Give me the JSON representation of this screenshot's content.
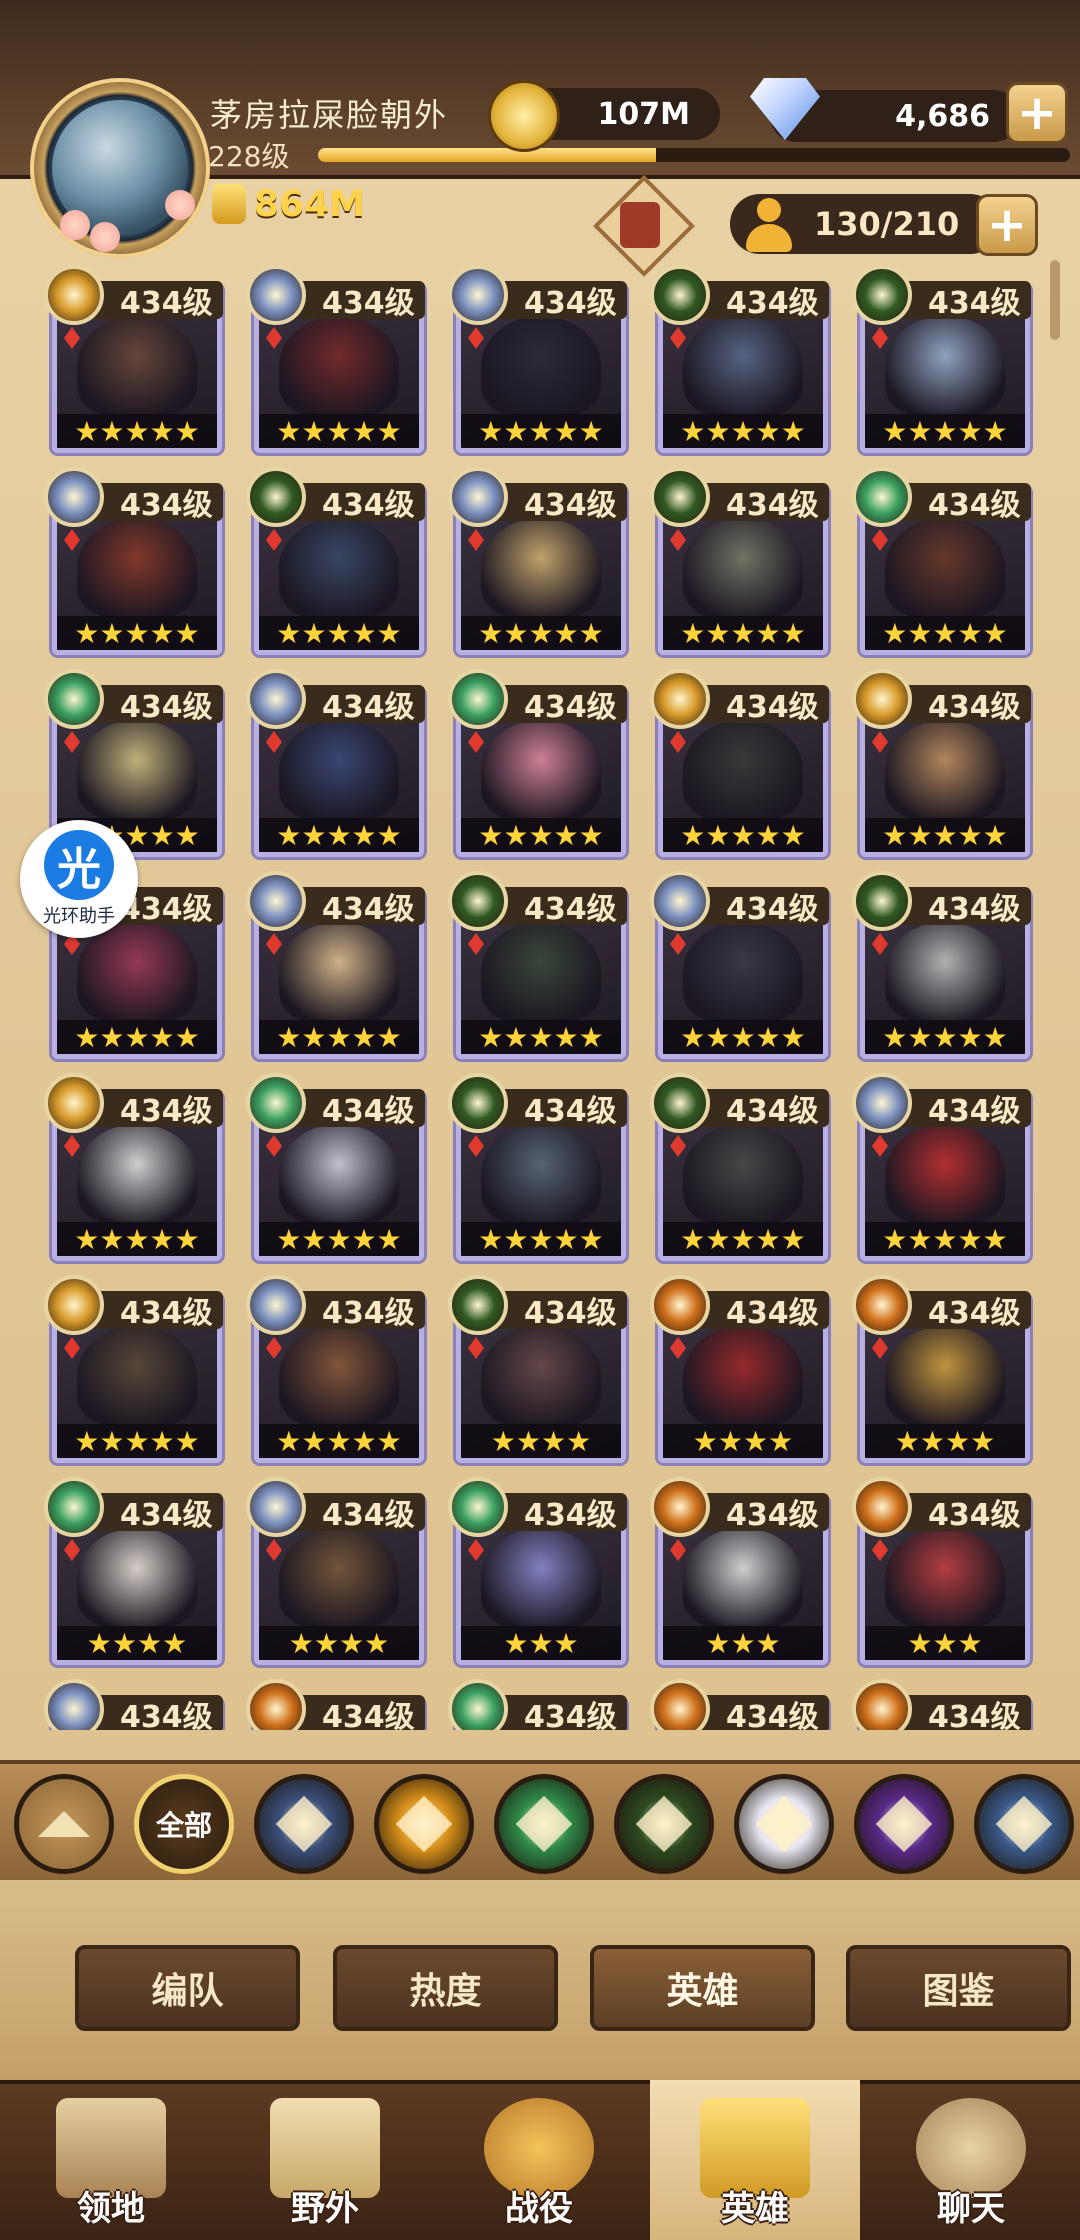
{
  "player": {
    "name": "茅房拉屎脸朝外",
    "level": "228级",
    "power": "864M",
    "xp_fraction": 0.45
  },
  "resources": {
    "gold": "107M",
    "gems": "4,686",
    "hero_count": "130/210"
  },
  "helper": {
    "logo_char": "光",
    "label": "光环助手"
  },
  "heroes": {
    "rows": [
      [
        {
          "level": "434级",
          "stars": "★★★★★",
          "faction": "lightbearer",
          "hue": "#6b4a3a"
        },
        {
          "level": "434级",
          "stars": "★★★★★",
          "faction": "celestial",
          "hue": "#7a2a2a"
        },
        {
          "level": "434级",
          "stars": "★★★★★",
          "faction": "celestial",
          "hue": "#2a2a3a"
        },
        {
          "level": "434级",
          "stars": "★★★★★",
          "faction": "graveborn",
          "hue": "#5a6a8a"
        },
        {
          "level": "434级",
          "stars": "★★★★★",
          "faction": "graveborn",
          "hue": "#9ab0d0"
        }
      ],
      [
        {
          "level": "434级",
          "stars": "★★★★★",
          "faction": "celestial",
          "hue": "#8a3a2a"
        },
        {
          "level": "434级",
          "stars": "★★★★★",
          "faction": "graveborn",
          "hue": "#3a4a6a"
        },
        {
          "level": "434级",
          "stars": "★★★★★",
          "faction": "celestial",
          "hue": "#d0b070"
        },
        {
          "level": "434级",
          "stars": "★★★★★",
          "faction": "graveborn",
          "hue": "#7a7a6a"
        },
        {
          "level": "434级",
          "stars": "★★★★★",
          "faction": "wilder",
          "hue": "#6a3a2a"
        }
      ],
      [
        {
          "level": "434级",
          "stars": "★★★★★",
          "faction": "wilder",
          "hue": "#d0c080"
        },
        {
          "level": "434级",
          "stars": "★★★★★",
          "faction": "celestial",
          "hue": "#3a4a7a"
        },
        {
          "level": "434级",
          "stars": "★★★★★",
          "faction": "wilder",
          "hue": "#e08aa0"
        },
        {
          "level": "434级",
          "stars": "★★★★★",
          "faction": "lightbearer",
          "hue": "#3a3a3a"
        },
        {
          "level": "434级",
          "stars": "★★★★★",
          "faction": "lightbearer",
          "hue": "#c09060"
        }
      ],
      [
        {
          "level": "434级",
          "stars": "★★★★★",
          "faction": "mauler",
          "hue": "#a03a5a"
        },
        {
          "level": "434级",
          "stars": "★★★★★",
          "faction": "celestial",
          "hue": "#e0c090"
        },
        {
          "level": "434级",
          "stars": "★★★★★",
          "faction": "graveborn",
          "hue": "#3a4a3a"
        },
        {
          "level": "434级",
          "stars": "★★★★★",
          "faction": "celestial",
          "hue": "#3a3a4a"
        },
        {
          "level": "434级",
          "stars": "★★★★★",
          "faction": "graveborn",
          "hue": "#c0c0c0"
        }
      ],
      [
        {
          "level": "434级",
          "stars": "★★★★★",
          "faction": "lightbearer",
          "hue": "#e0e0e0"
        },
        {
          "level": "434级",
          "stars": "★★★★★",
          "faction": "wilder",
          "hue": "#d0d0e0"
        },
        {
          "level": "434级",
          "stars": "★★★★★",
          "faction": "graveborn",
          "hue": "#5a6a7a"
        },
        {
          "level": "434级",
          "stars": "★★★★★",
          "faction": "graveborn",
          "hue": "#4a4a4a"
        },
        {
          "level": "434级",
          "stars": "★★★★★",
          "faction": "celestial",
          "hue": "#c03030"
        }
      ],
      [
        {
          "level": "434级",
          "stars": "★★★★★",
          "faction": "lightbearer",
          "hue": "#5a4a3a"
        },
        {
          "level": "434级",
          "stars": "★★★★★",
          "faction": "celestial",
          "hue": "#8a5a3a"
        },
        {
          "level": "434级",
          "stars": "★★★★",
          "faction": "graveborn",
          "hue": "#6a4a4a"
        },
        {
          "level": "434级",
          "stars": "★★★★",
          "faction": "mauler",
          "hue": "#a02a2a"
        },
        {
          "level": "434级",
          "stars": "★★★★",
          "faction": "mauler",
          "hue": "#d0a040"
        }
      ],
      [
        {
          "level": "434级",
          "stars": "★★★★",
          "faction": "wilder",
          "hue": "#e8e0d8"
        },
        {
          "level": "434级",
          "stars": "★★★★",
          "faction": "celestial",
          "hue": "#7a5a3a"
        },
        {
          "level": "434级",
          "stars": "★★★",
          "faction": "wilder",
          "hue": "#8a8ad0"
        },
        {
          "level": "434级",
          "stars": "★★★",
          "faction": "mauler",
          "hue": "#e0e0e0"
        },
        {
          "level": "434级",
          "stars": "★★★",
          "faction": "mauler",
          "hue": "#c04040"
        }
      ],
      [
        {
          "level": "434级",
          "stars": "",
          "faction": "celestial",
          "hue": "#6a5a4a"
        },
        {
          "level": "434级",
          "stars": "",
          "faction": "mauler",
          "hue": "#6a5a4a"
        },
        {
          "level": "434级",
          "stars": "",
          "faction": "wilder",
          "hue": "#6a5a4a"
        },
        {
          "level": "434级",
          "stars": "",
          "faction": "mauler",
          "hue": "#6a5a4a"
        },
        {
          "level": "434级",
          "stars": "",
          "faction": "mauler",
          "hue": "#6a5a4a"
        }
      ]
    ]
  },
  "filters": {
    "all_label": "全部",
    "items": [
      {
        "name": "lightbearer",
        "color": "#3a4f7a"
      },
      {
        "name": "mauler",
        "color": "#d8901a"
      },
      {
        "name": "wilder",
        "color": "#2f8a4a"
      },
      {
        "name": "graveborn",
        "color": "#2d4a22"
      },
      {
        "name": "celestial",
        "color": "#e8e8f2"
      },
      {
        "name": "hypogean",
        "color": "#5a2a8a"
      },
      {
        "name": "dimensional",
        "color": "#3a5a8a"
      }
    ]
  },
  "tabs": [
    {
      "label": "编队",
      "active": false
    },
    {
      "label": "热度",
      "active": false
    },
    {
      "label": "英雄",
      "active": true
    },
    {
      "label": "图鉴",
      "active": false
    }
  ],
  "bottom_nav": [
    {
      "label": "领地",
      "icon": "castle-icon",
      "active": false
    },
    {
      "label": "野外",
      "icon": "scroll-map-icon",
      "active": false
    },
    {
      "label": "战役",
      "icon": "sword-crest-icon",
      "active": false
    },
    {
      "label": "英雄",
      "icon": "hero-helmet-icon",
      "active": true
    },
    {
      "label": "聊天",
      "icon": "chat-bubble-icon",
      "active": false
    }
  ],
  "colors": {
    "faction_lightbearer": "#d89a2a",
    "faction_mauler": "#d0701a",
    "faction_wilder": "#3aa060",
    "faction_graveborn": "#2f5a22",
    "faction_celestial": "#7a90c0"
  }
}
